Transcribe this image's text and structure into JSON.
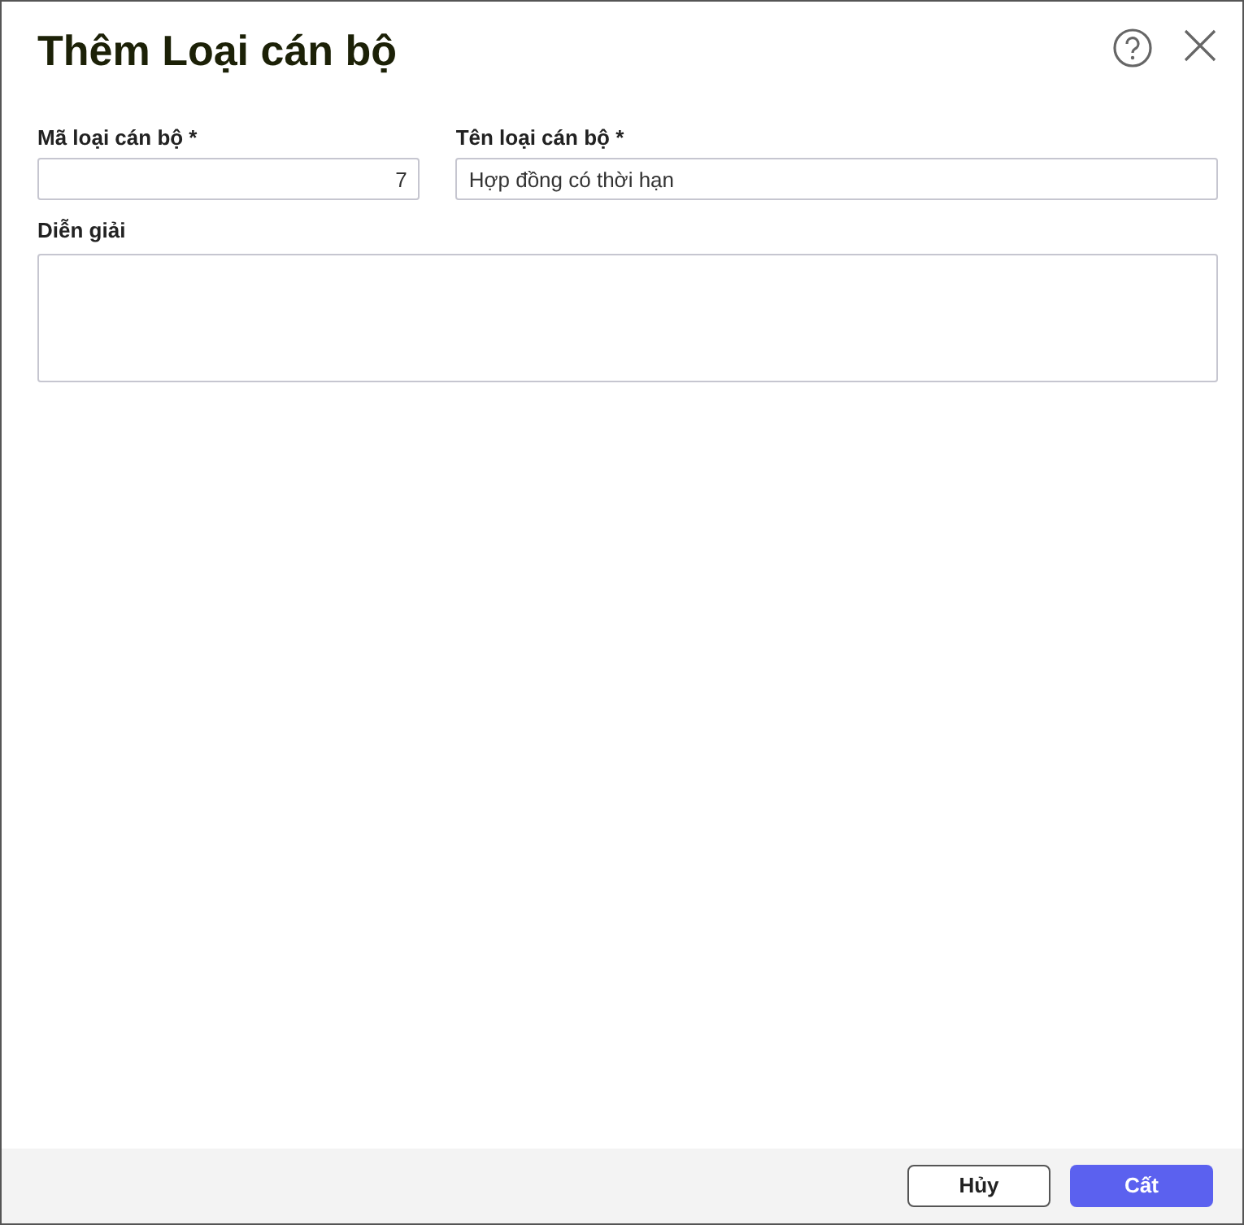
{
  "dialog": {
    "title": "Thêm Loại cán bộ"
  },
  "fields": [
    {
      "label": "Mã loại cán bộ *",
      "value": "7",
      "kind": "number"
    },
    {
      "label": "Tên loại cán bộ *",
      "value": "Hợp đồng có thời hạn",
      "kind": "text"
    }
  ],
  "description": {
    "label": "Diễn giải"
  },
  "buttons": [
    {
      "label": "Hủy",
      "kind": "secondary"
    },
    {
      "label": "Cất",
      "kind": "primary"
    }
  ]
}
